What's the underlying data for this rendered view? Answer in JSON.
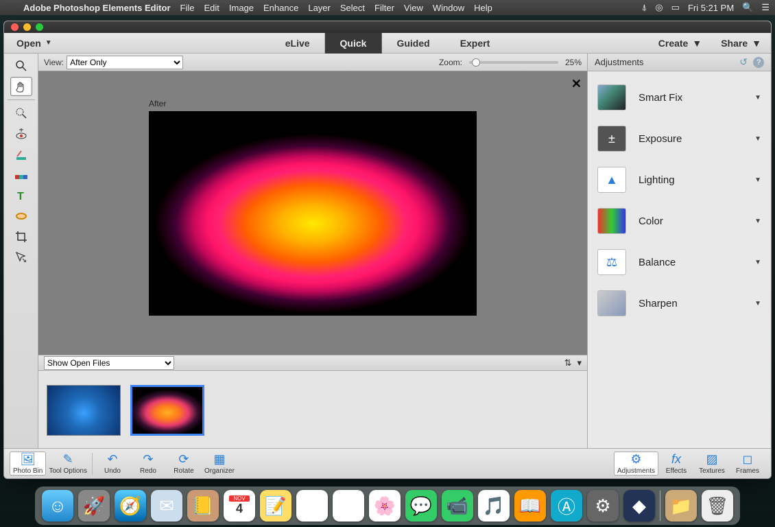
{
  "menubar": {
    "app_name": "Adobe Photoshop Elements Editor",
    "items": [
      "File",
      "Edit",
      "Image",
      "Enhance",
      "Layer",
      "Select",
      "Filter",
      "View",
      "Window",
      "Help"
    ],
    "clock": "Fri 5:21 PM"
  },
  "modebar": {
    "open_label": "Open",
    "modes": [
      "eLive",
      "Quick",
      "Guided",
      "Expert"
    ],
    "active_mode": "Quick",
    "create_label": "Create",
    "share_label": "Share"
  },
  "viewbar": {
    "label": "View:",
    "selected": "After Only",
    "zoom_label": "Zoom:",
    "zoom_value": "25%"
  },
  "canvas": {
    "after_label": "After"
  },
  "binbar": {
    "selected": "Show Open Files"
  },
  "right_panel": {
    "heading": "Adjustments",
    "items": [
      "Smart Fix",
      "Exposure",
      "Lighting",
      "Color",
      "Balance",
      "Sharpen"
    ]
  },
  "bottom": {
    "left": [
      "Photo Bin",
      "Tool Options",
      "Undo",
      "Redo",
      "Rotate",
      "Organizer"
    ],
    "right": [
      "Adjustments",
      "Effects",
      "Textures",
      "Frames"
    ]
  },
  "tools": [
    "zoom",
    "hand",
    "quick-select",
    "redeye",
    "whiten",
    "spot-heal",
    "text",
    "draw",
    "crop",
    "move"
  ],
  "dock": [
    "finder",
    "launchpad",
    "safari",
    "mail",
    "contacts",
    "calendar",
    "notes",
    "reminders",
    "maps",
    "photos",
    "messages",
    "facetime",
    "itunes",
    "ibooks",
    "appstore",
    "settings",
    "pse",
    "gallery",
    "trash"
  ]
}
